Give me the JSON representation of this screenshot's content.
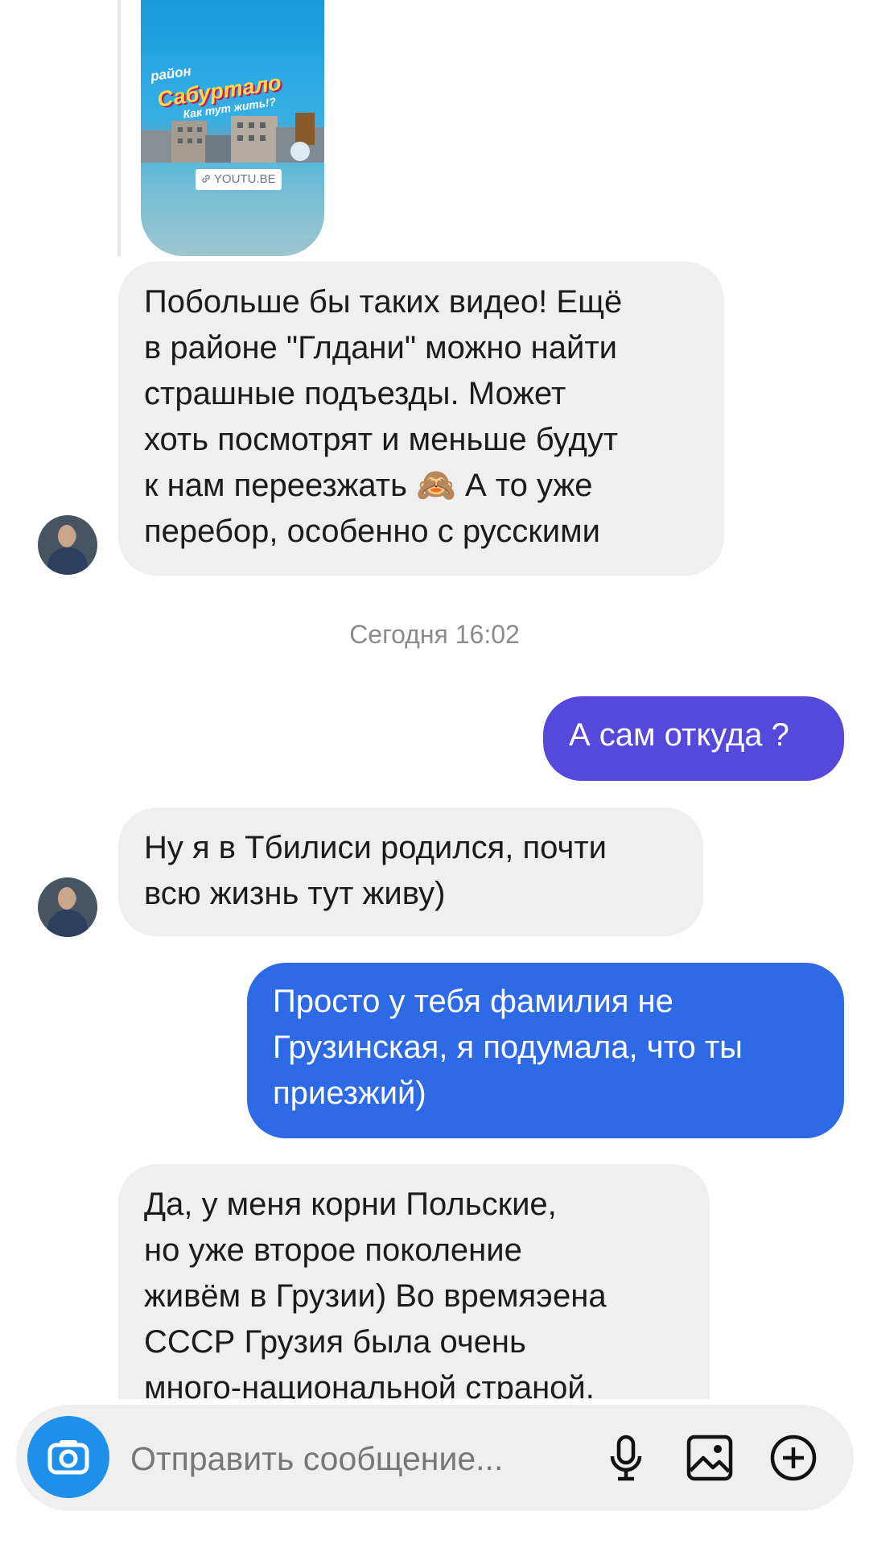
{
  "shared_post": {
    "title_line1": "район",
    "title_line2": "Сабуртало",
    "title_line3": "Как тут жить!?",
    "link_domain": "YOUTU.BE"
  },
  "messages": [
    {
      "side": "in",
      "text": "Побольше бы таких видео! Ещё\nв районе \"Глдани\" можно найти\nстрашные подъезды. Может\nхоть посмотрят и меньше будут\nк нам переезжать 🙈 А то уже\nперебор, особенно с русскими"
    },
    {
      "side": "out",
      "text": "А сам откуда ?"
    },
    {
      "side": "in",
      "text": "Ну я в Тбилиси родился, почти\nвсю жизнь тут живу)"
    },
    {
      "side": "out",
      "text": "Просто у тебя фамилия не\nГрузинская, я подумала, что ты\nприезжий)"
    },
    {
      "side": "in",
      "text": "Да, у меня корни Польские,\nно уже второе поколение\nживём в Грузии) Во времяэена\nСССР Грузия была очень\nмного-национальной страной."
    }
  ],
  "timestamp": "Сегодня 16:02",
  "composer": {
    "placeholder": "Отправить сообщение..."
  },
  "icons": {
    "camera": "camera-icon",
    "mic": "microphone-icon",
    "gallery": "image-icon",
    "add": "plus-circle-icon"
  },
  "colors": {
    "incoming_bubble": "#efefef",
    "outgoing_bubble_1": "#5549dc",
    "outgoing_bubble_2": "#2f6ae6",
    "camera_button": "#1e8fea",
    "timestamp_text": "#8b8b8b"
  }
}
